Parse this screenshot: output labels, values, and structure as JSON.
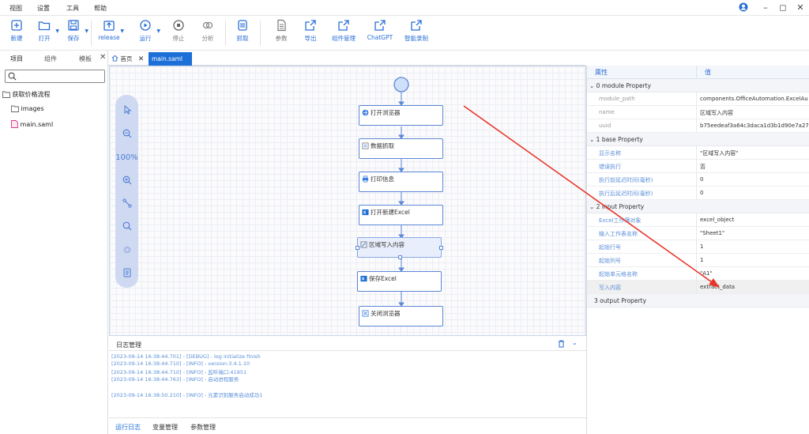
{
  "menu": [
    "视图",
    "设置",
    "工具",
    "帮助"
  ],
  "toolbar": [
    {
      "label": "新建",
      "icon": "new-icon"
    },
    {
      "label": "打开",
      "icon": "open-folder-icon"
    },
    {
      "label": "保存",
      "icon": "save-icon"
    },
    {
      "label": "release",
      "icon": "release-icon"
    },
    {
      "label": "运行",
      "icon": "run-icon"
    },
    {
      "label": "停止",
      "icon": "stop-icon"
    },
    {
      "label": "分析",
      "icon": "analyze-icon"
    },
    {
      "label": "抓取",
      "icon": "capture-icon"
    },
    {
      "label": "参数",
      "icon": "params-icon"
    },
    {
      "label": "导出",
      "icon": "export-icon"
    },
    {
      "label": "组件管理",
      "icon": "component-manage-icon"
    },
    {
      "label": "ChatGPT",
      "icon": "chatgpt-icon"
    },
    {
      "label": "智能录制",
      "icon": "smart-record-icon"
    }
  ],
  "left_tabs": [
    "项目",
    "组件",
    "模板"
  ],
  "tree": {
    "root": "获取价格流程",
    "items": [
      "images",
      "main.saml"
    ]
  },
  "tabs": [
    {
      "label": "首页"
    },
    {
      "label": "main.saml"
    }
  ],
  "zoom": "100%",
  "flow_nodes": [
    "打开浏览器",
    "数据抓取",
    "打印信息",
    "打开新建Excel",
    "区域写入内容",
    "保存Excel",
    "关闭浏览器"
  ],
  "log": {
    "title": "日志管理",
    "lines": [
      "[2023-09-14 16:38:44.701] - [DEBUG] - log initialize finish",
      "[2023-09-14 16:38:44.710] - [INFO] - version:3.4.1.10",
      "[2023-09-14 16:38:44.710] - [INFO] - 监听端口:41951",
      "[2023-09-14 16:38:44.763] - [INFO] - 启动进程服务",
      "[2023-09-14 16:38:50.210] - [INFO] - 元素识别服务启动成功1"
    ],
    "tabs": [
      "运行日志",
      "变量管理",
      "参数管理"
    ]
  },
  "props": {
    "col_key": "属性",
    "col_val": "值",
    "sections": [
      {
        "title": "0 module Property",
        "rows": [
          {
            "k": "module_path",
            "v": "components.OfficeAutomation.ExcelAu..."
          },
          {
            "k": "name",
            "v": "区域写入内容"
          },
          {
            "k": "uuid",
            "v": "b75eedeaf3a64c3daca1d3b1d90e7a27"
          }
        ]
      },
      {
        "title": "1 base Property",
        "rows": [
          {
            "k": "显示名称",
            "v": "\"区域写入内容\""
          },
          {
            "k": "错误执行",
            "v": "否"
          },
          {
            "k": "执行前延迟时间(毫秒)",
            "v": "0"
          },
          {
            "k": "执行后延迟时间(毫秒)",
            "v": "0"
          }
        ]
      },
      {
        "title": "2 input Property",
        "rows": [
          {
            "k": "Excel工作簿对象",
            "v": "excel_object"
          },
          {
            "k": "输入工作表名称",
            "v": "\"Sheet1\""
          },
          {
            "k": "起始行号",
            "v": "1"
          },
          {
            "k": "起始列号",
            "v": "1"
          },
          {
            "k": "起始单元格名称",
            "v": "\"A1\""
          },
          {
            "k": "写入内容",
            "v": "extract_data"
          }
        ]
      },
      {
        "title": "3 output Property",
        "rows": []
      }
    ]
  },
  "colors": {
    "accent": "#1d6fd8",
    "arrow": "#e8352a"
  }
}
